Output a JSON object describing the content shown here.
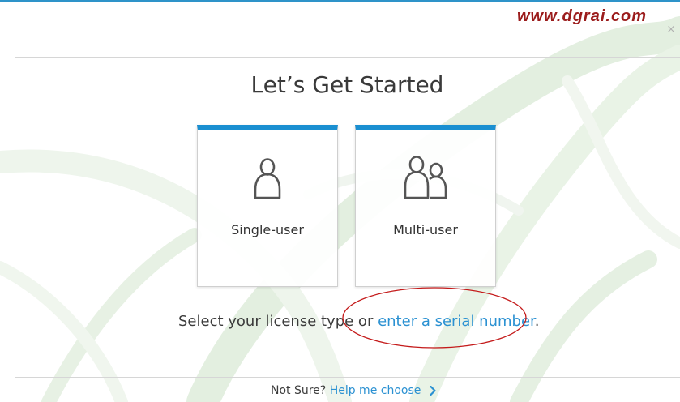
{
  "watermark": "www.dgrai.com",
  "close_glyph": "×",
  "title": "Let’s Get Started",
  "cards": [
    {
      "label": "Single-user",
      "icon": "single-user-icon"
    },
    {
      "label": "Multi-user",
      "icon": "multi-user-icon"
    }
  ],
  "prompt": {
    "text": "Select your license type or ",
    "link": "enter a serial number",
    "suffix": "."
  },
  "footer": {
    "question": "Not Sure?",
    "link": "Help me choose"
  },
  "colors": {
    "accent": "#1a8fd1",
    "link": "#2b91d2",
    "annotation": "#c41a1a",
    "watermark": "#9b1c1c"
  }
}
